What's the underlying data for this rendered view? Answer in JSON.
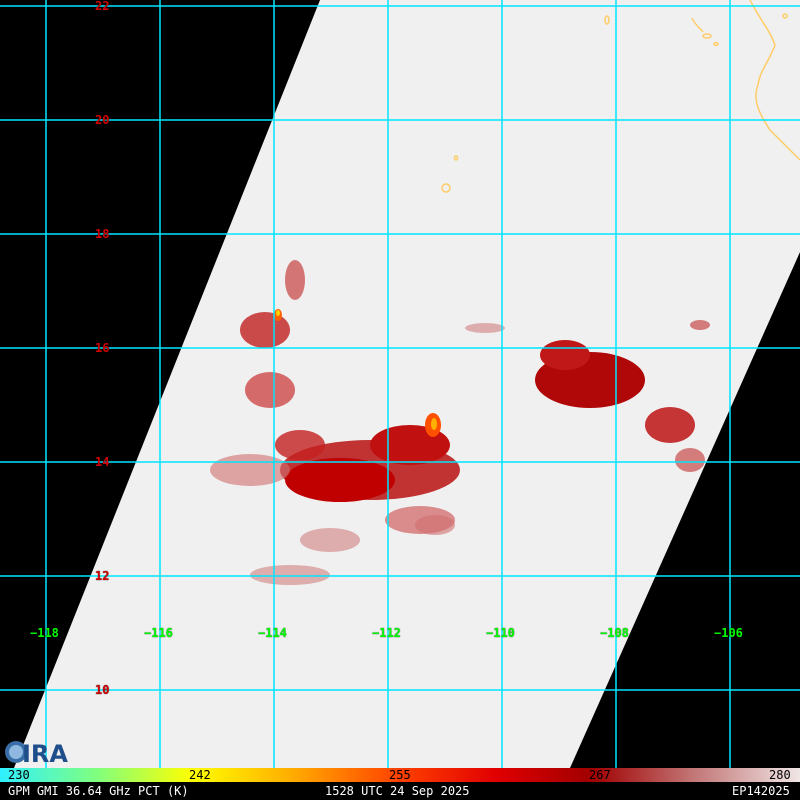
{
  "map": {
    "lat_labels": [
      "22",
      "20",
      "18",
      "16",
      "14",
      "12",
      "10"
    ],
    "lon_labels": [
      "−118",
      "−116",
      "−114",
      "−112",
      "−110",
      "−108",
      "−106"
    ],
    "colors": {
      "background": "#000000",
      "swath": "#f0f0f0",
      "grid": "#00e5ff",
      "coast": "#ffcc66",
      "lat_text": "#d00000",
      "lon_text": "#00ff00"
    }
  },
  "colorbar": {
    "ticks": [
      "230",
      "242",
      "255",
      "267",
      "280"
    ]
  },
  "footer": {
    "product": "GPM GMI 36.64 GHz PCT (K)",
    "time": "1528 UTC 24 Sep 2025",
    "storm_id": "EP142025"
  },
  "logo": {
    "text": "CIRA",
    "icon": "cira-logo-icon"
  }
}
